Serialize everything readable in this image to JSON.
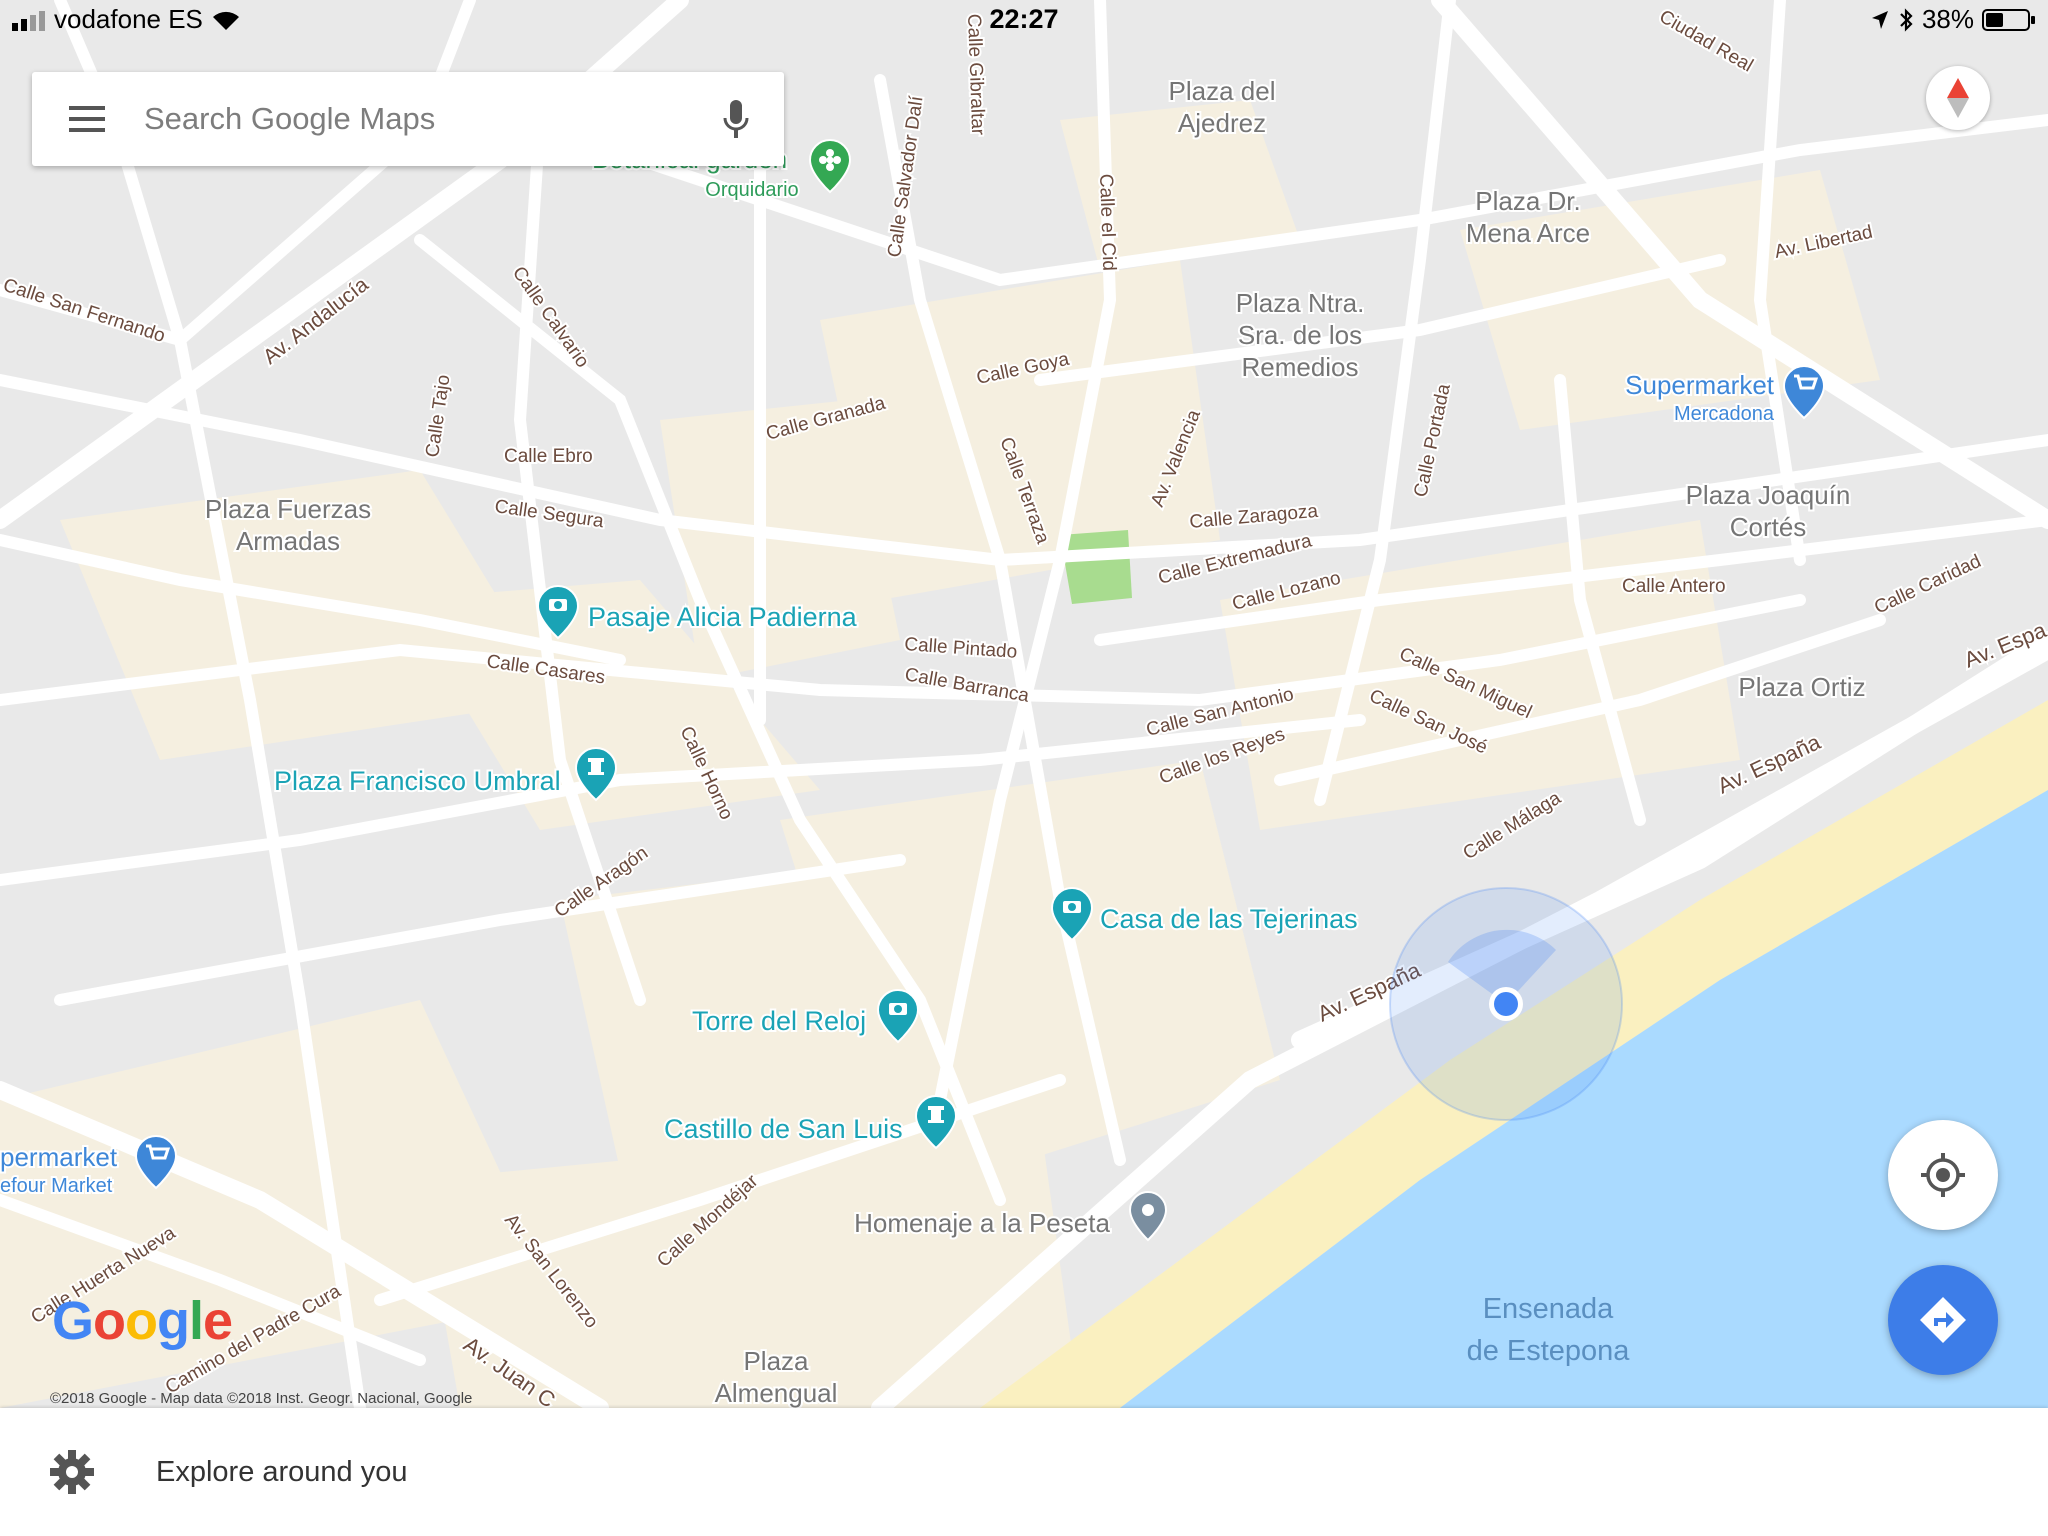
{
  "status_bar": {
    "carrier": "vodafone ES",
    "time": "22:27",
    "battery": "38%"
  },
  "search": {
    "placeholder": "Search Google Maps"
  },
  "streets": [
    "Calle San Fernando",
    "Av. Andalucía",
    "Calle Calvario",
    "Calle Tajo",
    "Calle Ebro",
    "Calle Segura",
    "Calle Casares",
    "Calle Horno",
    "Calle Aragón",
    "Calle Granada",
    "Calle Goya",
    "Calle Terraza",
    "Av. Valencia",
    "Calle Zaragoza",
    "Calle Extremadura",
    "Calle Lozano",
    "Calle Pintado",
    "Calle Barranca",
    "Calle San Antonio",
    "Calle los Reyes",
    "Calle San Miguel",
    "Calle San José",
    "Calle Málaga",
    "Av. España",
    "Calle Antero",
    "Calle Caridad",
    "Av. Libertad",
    "Calle Portada",
    "Calle Gibraltar",
    "Calle Salvador Dalí",
    "Calle el Cid",
    "Calle Mondéjar",
    "Av. San Lorenzo",
    "Calle Huerta Nueva",
    "Camino del Padre Cura",
    "Av. Juan C",
    "Ciudad Real"
  ],
  "places": {
    "plaza_ajedrez": "Plaza del Ajedrez",
    "plaza_mena": "Plaza Dr. Mena Arce",
    "plaza_remedios": "Plaza Ntra. Sra. de los Remedios",
    "supermarket_name": "Supermarket",
    "supermarket_sub": "Mercadona",
    "plaza_joaquin": "Plaza Joaquín Cortés",
    "plaza_fuerzas": "Plaza Fuerzas Armadas",
    "pasaje": "Pasaje Alicia Padierna",
    "plaza_umbral": "Plaza Francisco Umbral",
    "plaza_ortiz": "Plaza Ortiz",
    "casa_tejerinas": "Casa de las Tejerinas",
    "torre_reloj": "Torre del Reloj",
    "castillo": "Castillo de San Luis",
    "homenaje": "Homenaje a la Peseta",
    "ensenada": "Ensenada de Estepona",
    "plaza_almengual": "Plaza Almengual",
    "supermarket2_name": "permarket",
    "supermarket2_sub": "efour Market",
    "botanical": "Orquidario",
    "botanical_top": "Botanical garden"
  },
  "map_attribution": "©2018 Google - Map data ©2018 Inst. Geogr. Nacional, Google",
  "logo": "Google",
  "bottom": {
    "explore_label": "Explore around you"
  },
  "colors": {
    "water": "#aadaff",
    "beach": "#faf0c0",
    "land": "#e8e8e8",
    "block": "#f3efe6",
    "road": "#ffffff",
    "poi_teal": "#1aa3b5",
    "poi_blue": "#3e87d8",
    "park_green": "#a8dc8f",
    "location_blue": "#4285f4"
  }
}
